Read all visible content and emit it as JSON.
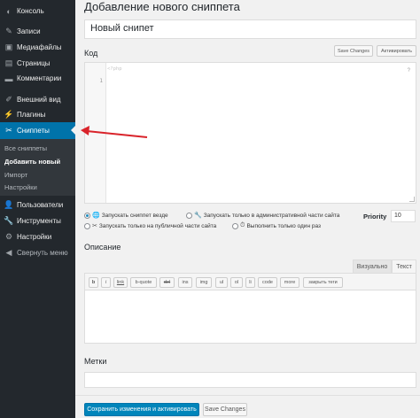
{
  "sidebar": {
    "items": [
      {
        "label": "Консоль",
        "icon": "dashboard-icon",
        "glyph": "◐"
      },
      {
        "label": "Записи",
        "icon": "pin-icon",
        "glyph": "✎"
      },
      {
        "label": "Медиафайлы",
        "icon": "media-icon",
        "glyph": "▣"
      },
      {
        "label": "Страницы",
        "icon": "pages-icon",
        "glyph": "▤"
      },
      {
        "label": "Комментарии",
        "icon": "comments-icon",
        "glyph": "▬"
      },
      {
        "label": "Внешний вид",
        "icon": "appearance-brush-icon",
        "glyph": "✐"
      },
      {
        "label": "Плагины",
        "icon": "plugins-icon",
        "glyph": "⚡"
      },
      {
        "label": "Сниппеты",
        "icon": "snippets-scissors-icon",
        "glyph": "✂"
      },
      {
        "label": "Пользователи",
        "icon": "users-icon",
        "glyph": "👤"
      },
      {
        "label": "Инструменты",
        "icon": "tools-wrench-icon",
        "glyph": "🔧"
      },
      {
        "label": "Настройки",
        "icon": "settings-icon",
        "glyph": "⚙"
      },
      {
        "label": "Свернуть меню",
        "icon": "collapse-icon",
        "glyph": "◀"
      }
    ],
    "submenu": [
      "Все сниппеты",
      "Добавить новый",
      "Импорт",
      "Настройки"
    ]
  },
  "main": {
    "page_title": "Добавление нового сниппета",
    "title_value": "Новый снипет",
    "code_label": "Код",
    "save_changes_small": "Save Changes",
    "activate_small": "Активировать",
    "code_hint": "<?php",
    "line_number": "1",
    "help_mark": "?",
    "scope": {
      "everywhere": "Запускать сниппет везде",
      "admin": "Запускать только в административной части сайта",
      "front": "Запускать только на публичной части сайта",
      "once": "Выполнить только один раз"
    },
    "priority_label": "Priority",
    "priority_value": "10",
    "description_label": "Описание",
    "tab_visual": "Визуально",
    "tab_text": "Текст",
    "quicktags": [
      "b",
      "i",
      "link",
      "b-quote",
      "del",
      "ins",
      "img",
      "ul",
      "ol",
      "li",
      "code",
      "more",
      "закрыть теги"
    ],
    "tags_label": "Метки",
    "save_activate_button": "Сохранить изменения и активировать",
    "save_changes_button": "Save Changes"
  },
  "colors": {
    "sidebar_bg": "#23282d",
    "active_blue": "#0073aa",
    "arrow_red": "#d9232a",
    "primary_button": "#0085ba"
  }
}
